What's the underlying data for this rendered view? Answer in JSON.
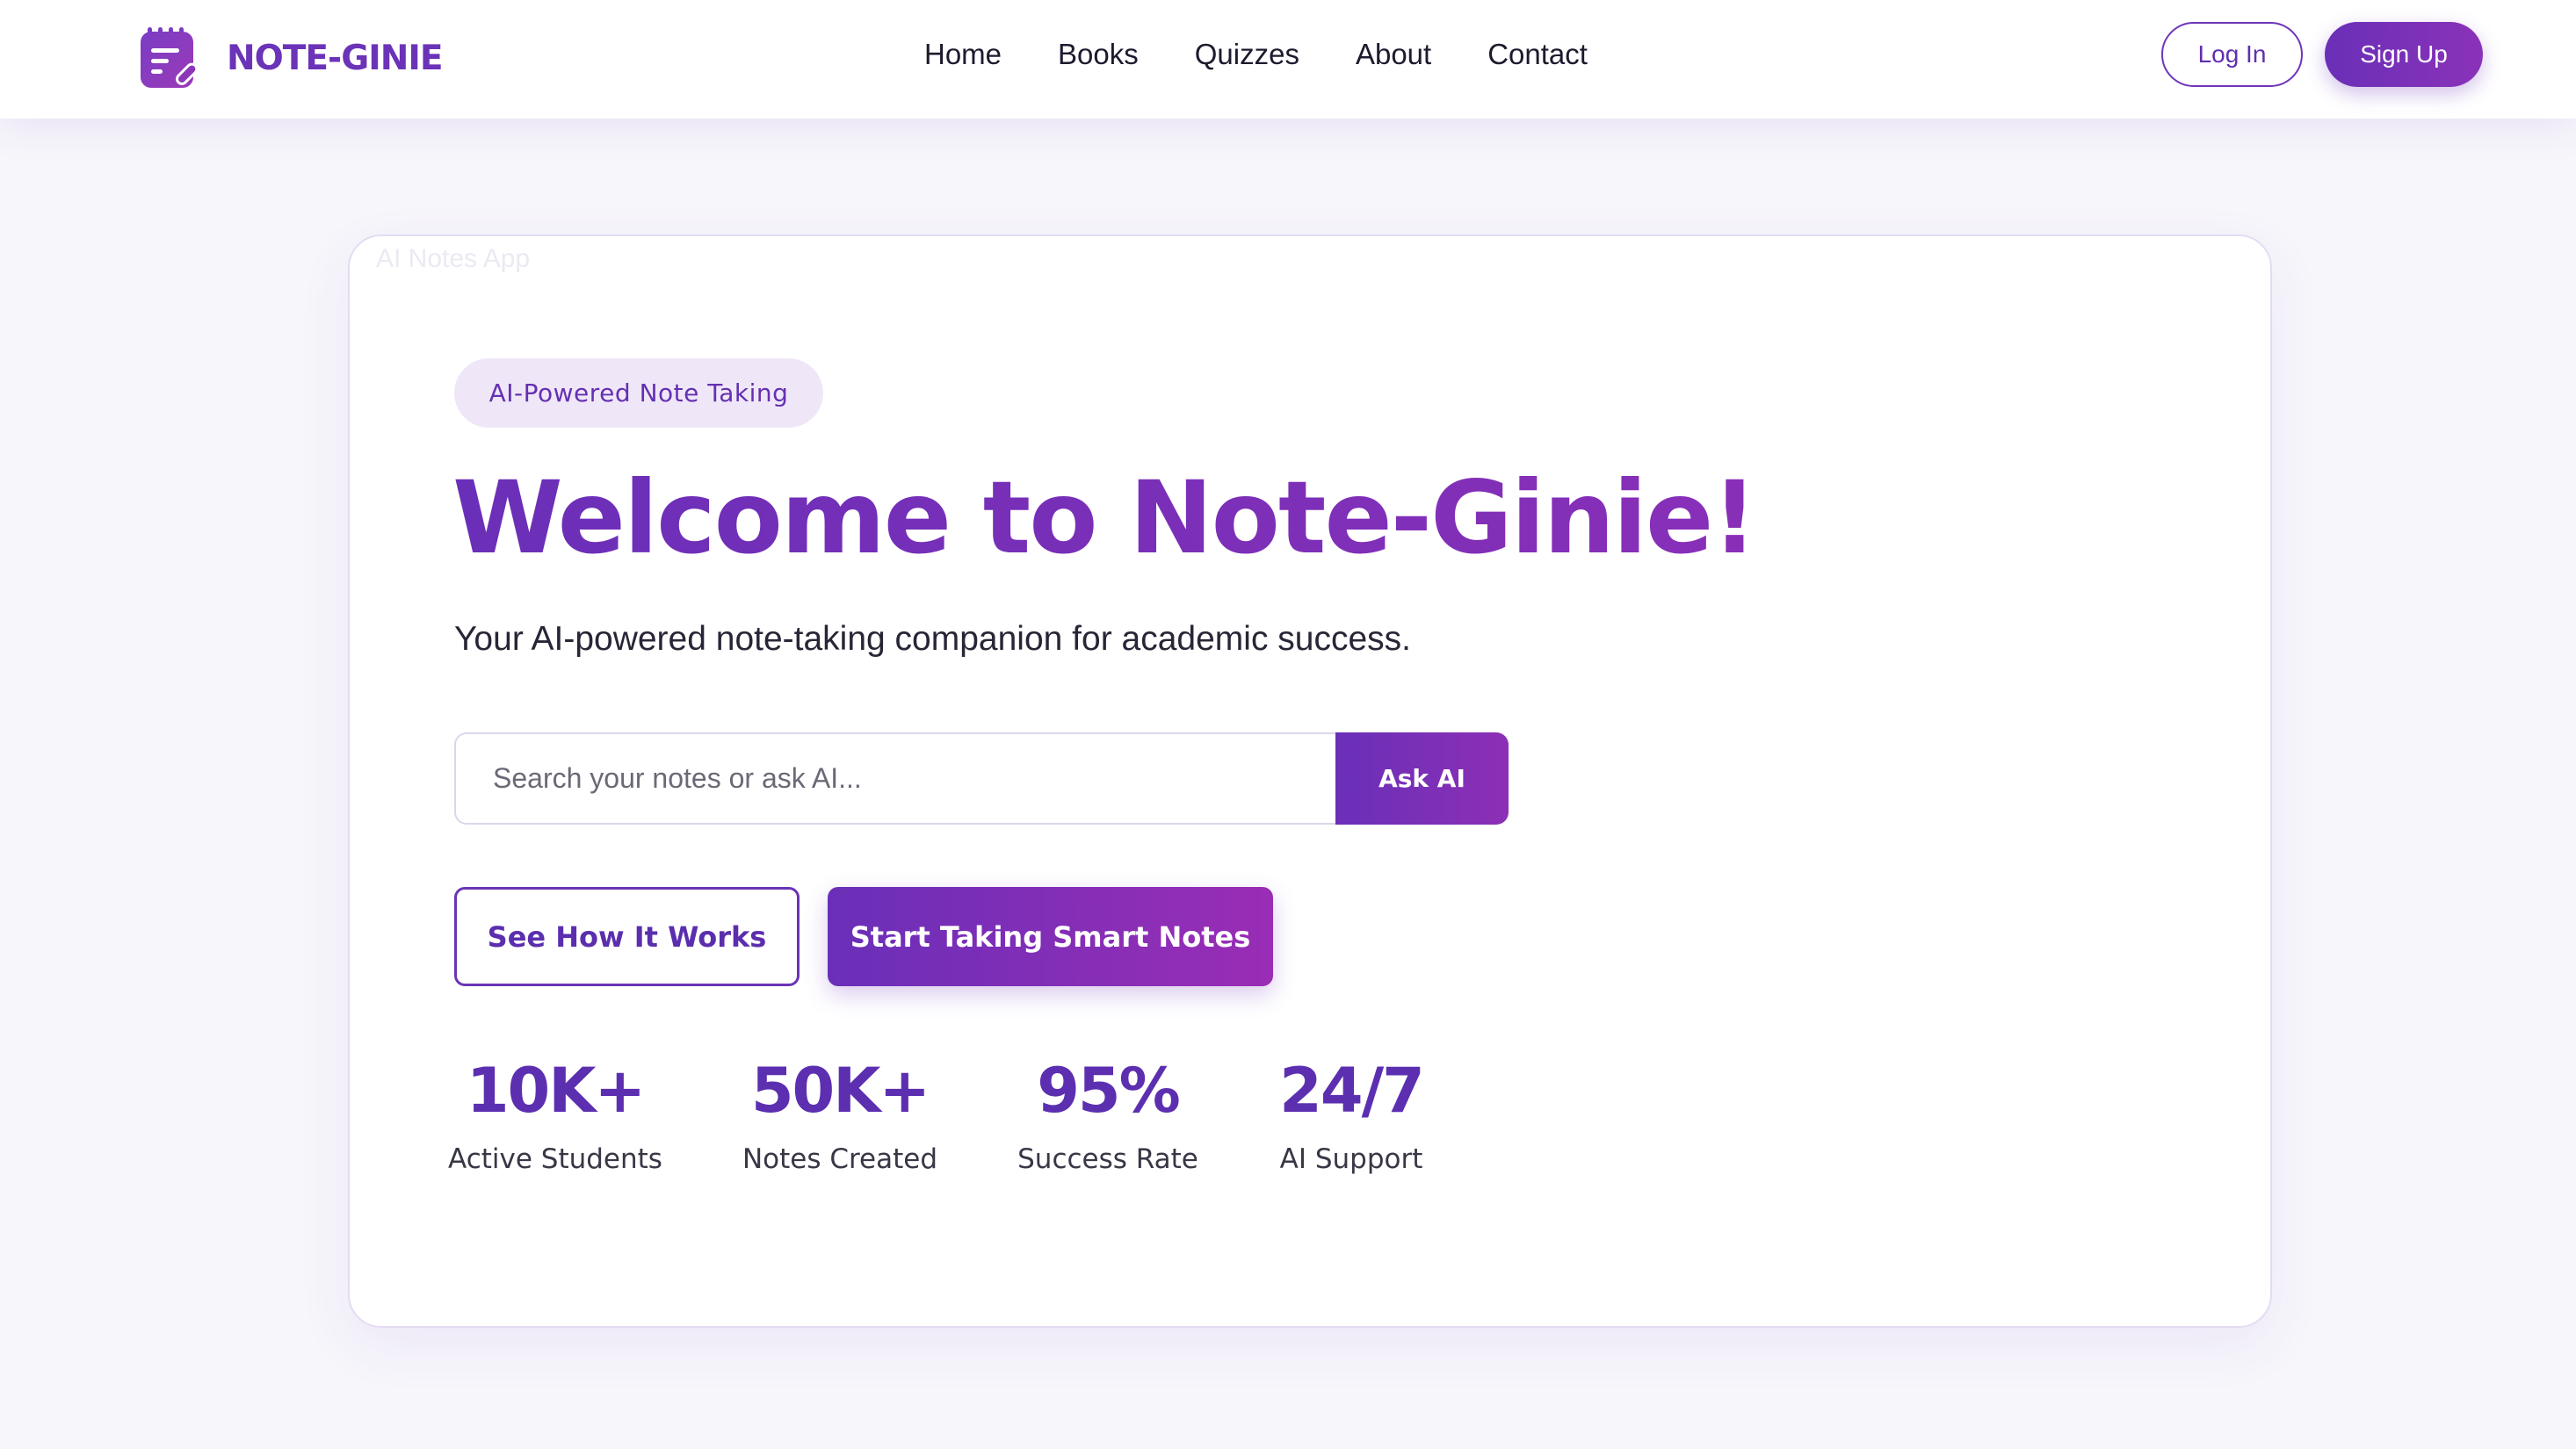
{
  "brand": {
    "name": "NOTE-GINIE",
    "icon": "notepad-pencil-icon",
    "accent": "#6b33b8"
  },
  "nav": {
    "links": [
      "Home",
      "Books",
      "Quizzes",
      "About",
      "Contact"
    ],
    "login_label": "Log In",
    "signup_label": "Sign Up"
  },
  "hero": {
    "ghost_label": "AI Notes App",
    "badge": "AI-Powered Note Taking",
    "title": "Welcome to Note-Ginie!",
    "subtitle": "Your AI-powered note-taking companion for academic success.",
    "search": {
      "placeholder": "Search your notes or ask AI...",
      "value": "",
      "button_label": "Ask AI"
    },
    "secondary_cta": "See How It Works",
    "primary_cta": "Start Taking Smart Notes"
  },
  "stats": [
    {
      "value": "10K+",
      "label": "Active Students"
    },
    {
      "value": "50K+",
      "label": "Notes Created"
    },
    {
      "value": "95%",
      "label": "Success Rate"
    },
    {
      "value": "24/7",
      "label": "AI Support"
    }
  ],
  "colors": {
    "primary": "#6a2fb8",
    "primary_end": "#8c2fb6",
    "background": "#f7f6fb",
    "badge_bg": "#efe7f8"
  }
}
